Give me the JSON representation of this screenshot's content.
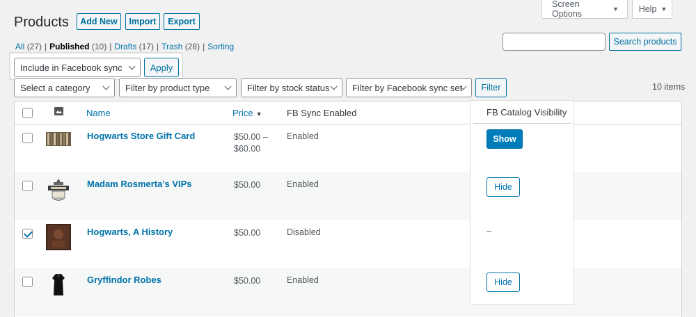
{
  "top_tabs": {
    "screen_options": "Screen Options",
    "help": "Help"
  },
  "header": {
    "title": "Products",
    "add_new": "Add New",
    "import": "Import",
    "export": "Export"
  },
  "views": {
    "all": "All",
    "all_count": "(27)",
    "published": "Published",
    "published_count": "(10)",
    "drafts": "Drafts",
    "drafts_count": "(17)",
    "trash": "Trash",
    "trash_count": "(28)",
    "sorting": "Sorting"
  },
  "search": {
    "button": "Search products",
    "value": ""
  },
  "bulk": {
    "selected": "Include in Facebook sync",
    "apply": "Apply"
  },
  "filters": {
    "category": "Select a category",
    "product_type": "Filter by product type",
    "stock_status": "Filter by stock status",
    "fb_sync_set": "Filter by Facebook sync set",
    "filter_button": "Filter"
  },
  "items_count": "10 items",
  "table": {
    "headers": {
      "name": "Name",
      "price": "Price",
      "fb_sync": "FB Sync Enabled",
      "fb_visibility": "FB Catalog Visibility"
    },
    "rows": [
      {
        "name": "Hogwarts Store Gift Card",
        "price_line1": "$50.00 –",
        "price_line2": "$60.00",
        "sync": "Enabled",
        "visibility": "Show",
        "checked": false
      },
      {
        "name": "Madam Rosmerta’s VIPs",
        "price_line1": "$50.00",
        "price_line2": "",
        "sync": "Enabled",
        "visibility": "Hide",
        "checked": false
      },
      {
        "name": "Hogwarts, A History",
        "price_line1": "$50.00",
        "price_line2": "",
        "sync": "Disabled",
        "visibility": "–",
        "checked": true
      },
      {
        "name": "Gryffindor Robes",
        "price_line1": "$50.00",
        "price_line2": "",
        "sync": "Enabled",
        "visibility": "Hide",
        "checked": false
      }
    ]
  },
  "colors": {
    "link": "#0073aa",
    "primary_button": "#007cba",
    "background": "#f1f1f1"
  },
  "icons": {
    "image_column": "image-icon",
    "sort": "sort-down-icon",
    "dropdown": "chevron-down-icon"
  }
}
